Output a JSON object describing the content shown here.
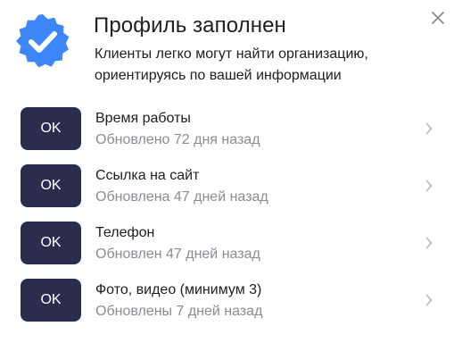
{
  "header": {
    "title": "Профиль заполнен",
    "subtitle_line1": "Клиенты легко могут найти организацию,",
    "subtitle_line2": "ориентируясь по вашей информации"
  },
  "icons": {
    "badge": "verified-check-badge-icon",
    "close": "close-icon",
    "chevron": "chevron-right-icon"
  },
  "colors": {
    "badge_blue": "#3c86f7",
    "button_dark": "#2c2c4d",
    "text_primary": "#21201f",
    "text_secondary": "#8c8b94"
  },
  "items": [
    {
      "button_label": "OK",
      "title": "Время работы",
      "subtitle": "Обновлено 72 дня назад"
    },
    {
      "button_label": "OK",
      "title": "Ссылка на сайт",
      "subtitle": "Обновлена 47 дней назад"
    },
    {
      "button_label": "OK",
      "title": "Телефон",
      "subtitle": "Обновлен 47 дней назад"
    },
    {
      "button_label": "OK",
      "title": "Фото, видео (минимум 3)",
      "subtitle": "Обновлены 7 дней назад"
    }
  ]
}
